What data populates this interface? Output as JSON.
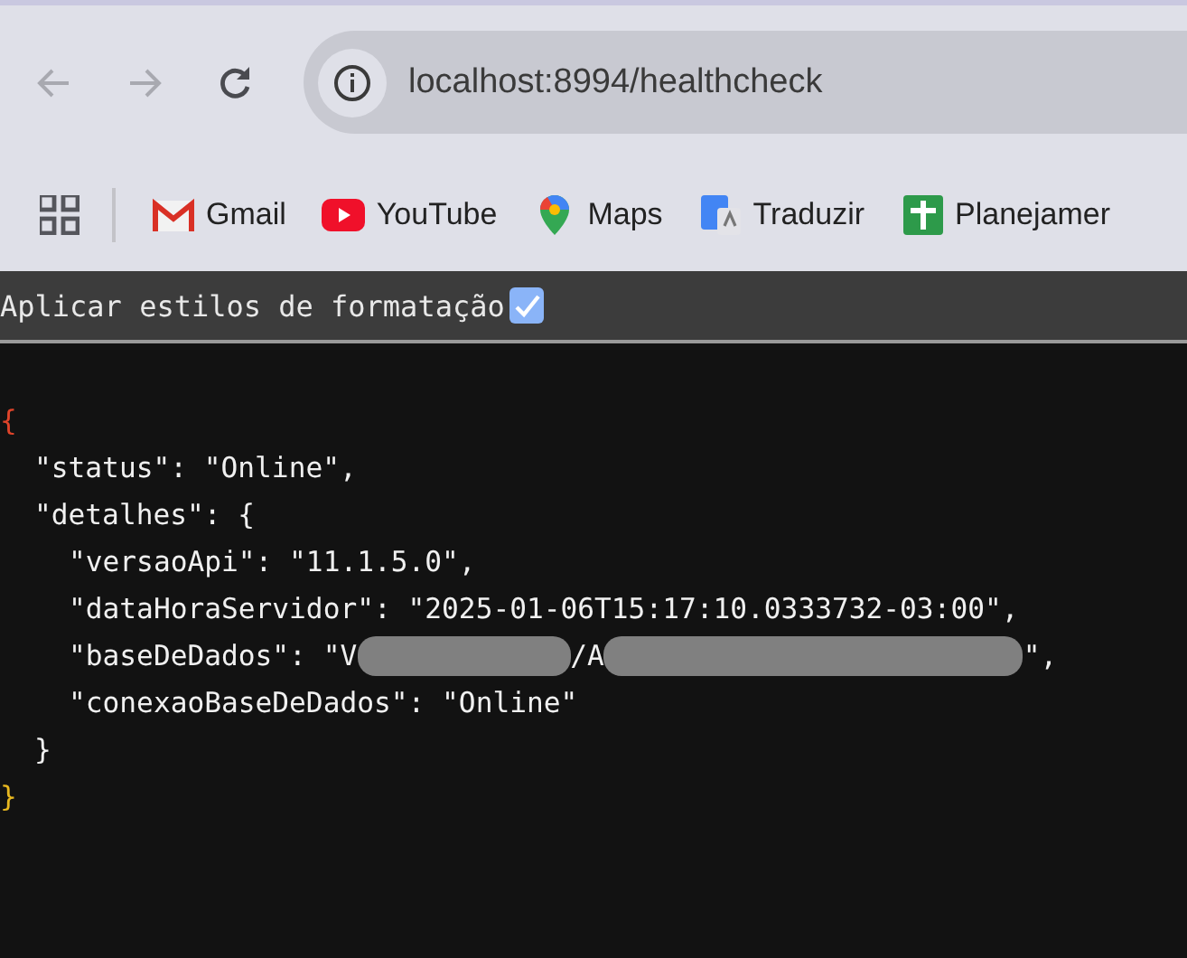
{
  "browser": {
    "back": {
      "disabled": true
    },
    "forward": {
      "disabled": true
    },
    "url": "localhost:8994/healthcheck",
    "bookmarks": [
      {
        "label": "Gmail",
        "kind": "gmail"
      },
      {
        "label": "YouTube",
        "kind": "youtube"
      },
      {
        "label": "Maps",
        "kind": "maps"
      },
      {
        "label": "Traduzir",
        "kind": "translate"
      },
      {
        "label": "Planejamer",
        "kind": "sheets"
      }
    ]
  },
  "format_toggle": {
    "label": "Aplicar estilos de formatação",
    "checked": true
  },
  "json_view": {
    "open": "{",
    "close": "}",
    "children": [
      {
        "kind": "line",
        "text": "\"status\": \"Online\","
      },
      {
        "kind": "block",
        "open": "\"detalhes\": {",
        "close": "}",
        "children": [
          {
            "kind": "line",
            "text": "\"versaoApi\": \"11.1.5.0\","
          },
          {
            "kind": "line",
            "text": "\"dataHoraServidor\": \"2025-01-06T15:17:10.0333732-03:00\","
          },
          {
            "kind": "redacted",
            "parts": [
              "\"baseDeDados\": \"V",
              "/A",
              "\","
            ]
          },
          {
            "kind": "line",
            "text": "\"conexaoBaseDeDados\": \"Online\""
          }
        ]
      }
    ]
  }
}
